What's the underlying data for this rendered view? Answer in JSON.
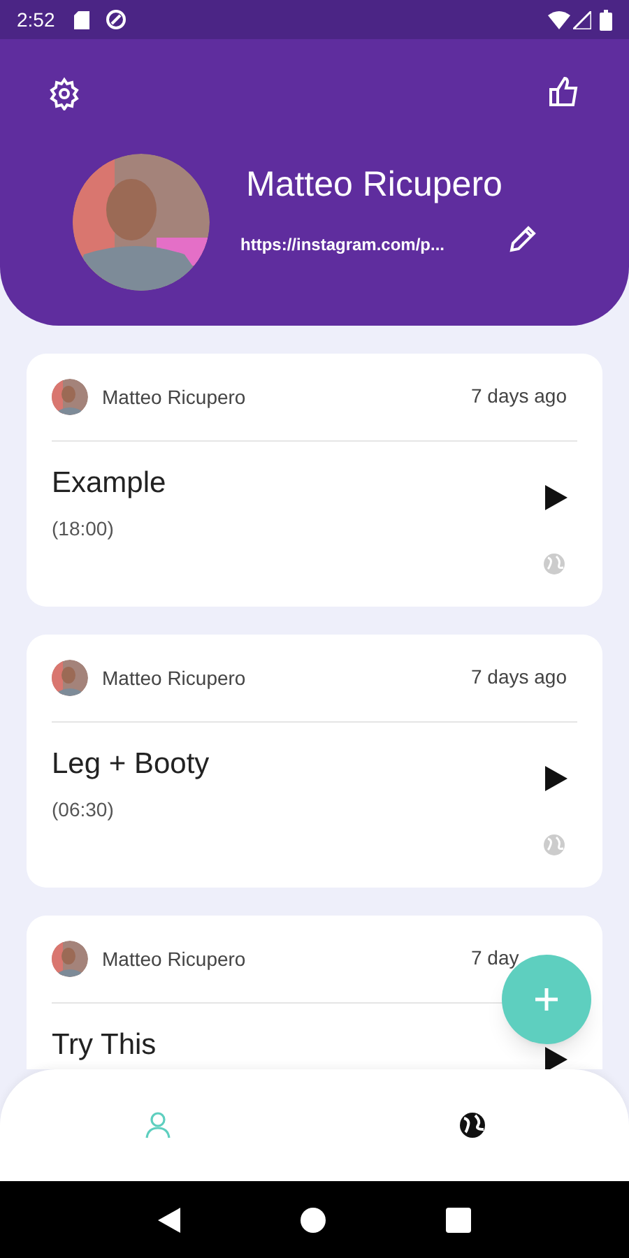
{
  "status_bar": {
    "time": "2:52"
  },
  "profile": {
    "name": "Matteo Ricupero",
    "link": "https://instagram.com/p..."
  },
  "workouts": [
    {
      "author": "Matteo Ricupero",
      "date": "7 days ago",
      "title": "Example",
      "duration": "(18:00)"
    },
    {
      "author": "Matteo Ricupero",
      "date": "7 days ago",
      "title": "Leg + Booty",
      "duration": "(06:30)"
    },
    {
      "author": "Matteo Ricupero",
      "date": "7 day",
      "title": "Try This"
    }
  ],
  "bottom_nav": [
    {
      "kind": "profile",
      "selected": true
    },
    {
      "kind": "globe",
      "selected": false
    }
  ]
}
